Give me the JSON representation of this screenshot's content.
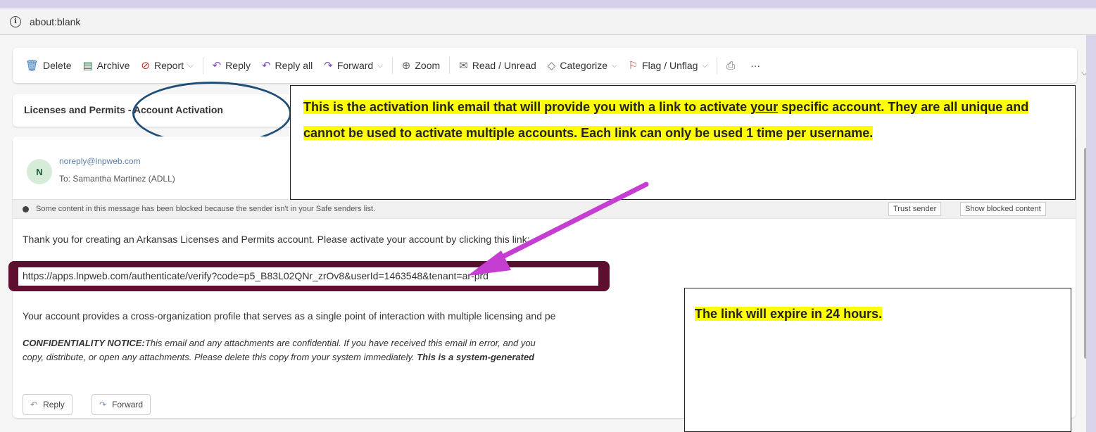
{
  "address": {
    "url": "about:blank"
  },
  "toolbar": {
    "delete": "Delete",
    "archive": "Archive",
    "report": "Report",
    "reply": "Reply",
    "reply_all": "Reply all",
    "forward": "Forward",
    "zoom": "Zoom",
    "read_unread": "Read / Unread",
    "categorize": "Categorize",
    "flag": "Flag / Unflag",
    "more": "···"
  },
  "email": {
    "subject": "Licenses and Permits - Account Activation",
    "avatar_initial": "N",
    "sender": "noreply@lnpweb.com",
    "to": "To:  Samantha Martinez (ADLL)",
    "blocked_notice": "Some content in this message has been blocked because the sender isn't in your Safe senders list.",
    "trust_sender": "Trust sender",
    "show_blocked": "Show blocked content",
    "body_line1": "Thank you for creating an Arkansas Licenses and Permits account. Please activate your account by clicking this link:",
    "activation_link": "https://apps.lnpweb.com/authenticate/verify?code=p5_B83L02QNr_zrOv8&userId=1463548&tenant=ar-prd",
    "body_line2": "Your account provides a cross-organization profile that serves as a single point of interaction with multiple licensing and pe",
    "notice_label": "CONFIDENTIALITY NOTICE:",
    "notice_text": "This email and any attachments are confidential. If you have received this email in error, and you",
    "notice_line2": "copy, distribute, or open any attachments. Please delete this copy from your system immediately. ",
    "notice_bold": "This is a system-generated",
    "reply_btn": "Reply",
    "forward_btn": "Forward"
  },
  "callouts": {
    "activation_part1": "This is the activation link email that will provide you with a link to activate ",
    "activation_underlined": "your",
    "activation_part2": " specific account. They are all unique and cannot be used to activate multiple accounts. Each link can only be used 1 time per username.",
    "expiry": "The link will expire in 24 hours."
  },
  "colors": {
    "link_highlight": "#5e0f2f",
    "ellipse": "#1f4e79",
    "arrow": "#c63dd1",
    "callout_highlight": "#ffff00"
  }
}
